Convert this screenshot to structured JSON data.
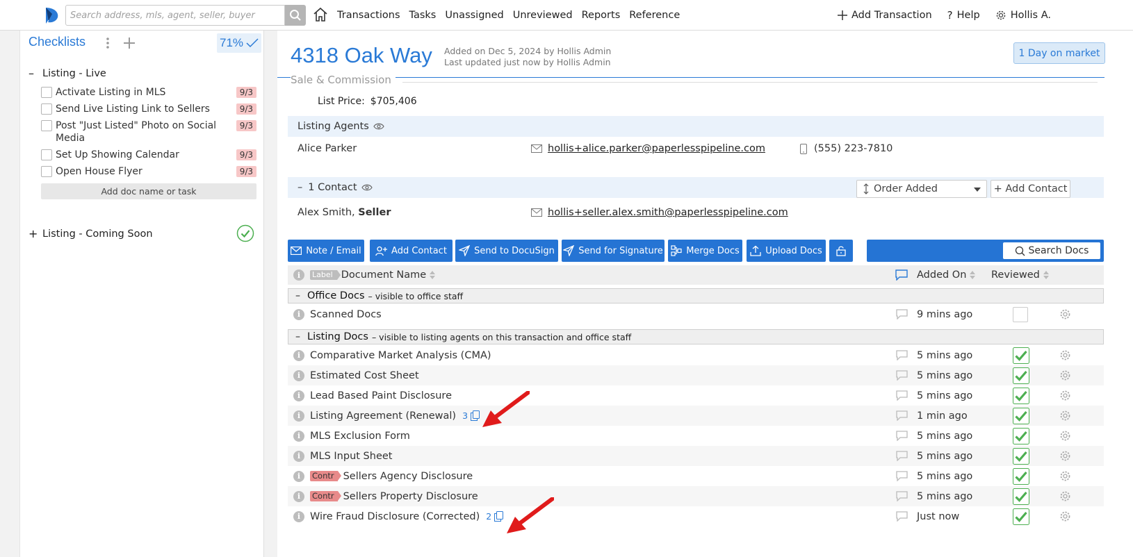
{
  "topbar": {
    "search_placeholder": "Search address, mls, agent, seller, buyer",
    "nav": [
      "Transactions",
      "Tasks",
      "Unassigned",
      "Unreviewed",
      "Reports",
      "Reference"
    ],
    "add_transaction": "Add Transaction",
    "help": "Help",
    "user": "Hollis A."
  },
  "sidebar": {
    "title": "Checklists",
    "percent": "71%",
    "group_live": "Listing - Live",
    "tasks": [
      {
        "label": "Activate Listing in MLS",
        "due": "9/3"
      },
      {
        "label": "Send Live Listing Link to Sellers",
        "due": "9/3"
      },
      {
        "label": "Post \"Just Listed\" Photo on Social Media",
        "due": "9/3"
      },
      {
        "label": "Set Up Showing Calendar",
        "due": "9/3"
      },
      {
        "label": "Open House Flyer",
        "due": "9/3"
      }
    ],
    "add_doc": "Add doc name or task",
    "group_soon": "Listing - Coming Soon"
  },
  "header": {
    "address": "4318 Oak Way",
    "added": "Added on Dec 5, 2024 by Hollis Admin",
    "updated": "Last updated just now by Hollis Admin",
    "days_on_market": "1 Day on market"
  },
  "sale": {
    "section_title": "Sale & Commission",
    "list_price_label": "List Price:",
    "list_price": "$705,406"
  },
  "agents": {
    "title": "Listing Agents",
    "name": "Alice Parker",
    "email": "hollis+alice.parker@paperlesspipeline.com",
    "phone": "(555) 223-7810"
  },
  "contacts": {
    "title": "1 Contact",
    "order": "Order Added",
    "add": "+ Add Contact",
    "name": "Alex Smith,",
    "role": "Seller",
    "email": "hollis+seller.alex.smith@paperlesspipeline.com"
  },
  "toolbar": {
    "note": "Note / Email",
    "add_contact": "Add Contact",
    "docusign": "Send to DocuSign",
    "signature": "Send for Signature",
    "merge": "Merge Docs",
    "upload": "Upload Docs",
    "search": "Search Docs"
  },
  "table": {
    "label_tag": "Label",
    "col_name": "Document Name",
    "col_added": "Added On",
    "col_reviewed": "Reviewed"
  },
  "office_group": {
    "title": "Office Docs",
    "desc": "– visible to office staff"
  },
  "office_docs": [
    {
      "name": "Scanned Docs",
      "added": "9 mins ago"
    }
  ],
  "listing_group": {
    "title": "Listing Docs",
    "desc": "– visible to listing agents on this transaction and office staff"
  },
  "listing_docs": [
    {
      "name": "Comparative Market Analysis (CMA)",
      "added": "5 mins ago"
    },
    {
      "name": "Estimated Cost Sheet",
      "added": "5 mins ago"
    },
    {
      "name": "Lead Based Paint Disclosure",
      "added": "5 mins ago"
    },
    {
      "name": "Listing Agreement (Renewal)",
      "added": "1 min ago",
      "versions": "3"
    },
    {
      "name": "MLS Exclusion Form",
      "added": "5 mins ago"
    },
    {
      "name": "MLS Input Sheet",
      "added": "5 mins ago"
    },
    {
      "name": "Sellers Agency Disclosure",
      "added": "5 mins ago",
      "tag": "Contr"
    },
    {
      "name": "Sellers Property Disclosure",
      "added": "5 mins ago",
      "tag": "Contr"
    },
    {
      "name": "Wire Fraud Disclosure (Corrected)",
      "added": "Just now",
      "versions": "2"
    }
  ],
  "colors": {
    "accent": "#2a7ad6",
    "toolbar": "#2574d4",
    "due_badge": "#f7c7c7",
    "contr_tag": "#e88a8a",
    "check_green": "#4caf50",
    "arrow": "#e01b1b"
  }
}
